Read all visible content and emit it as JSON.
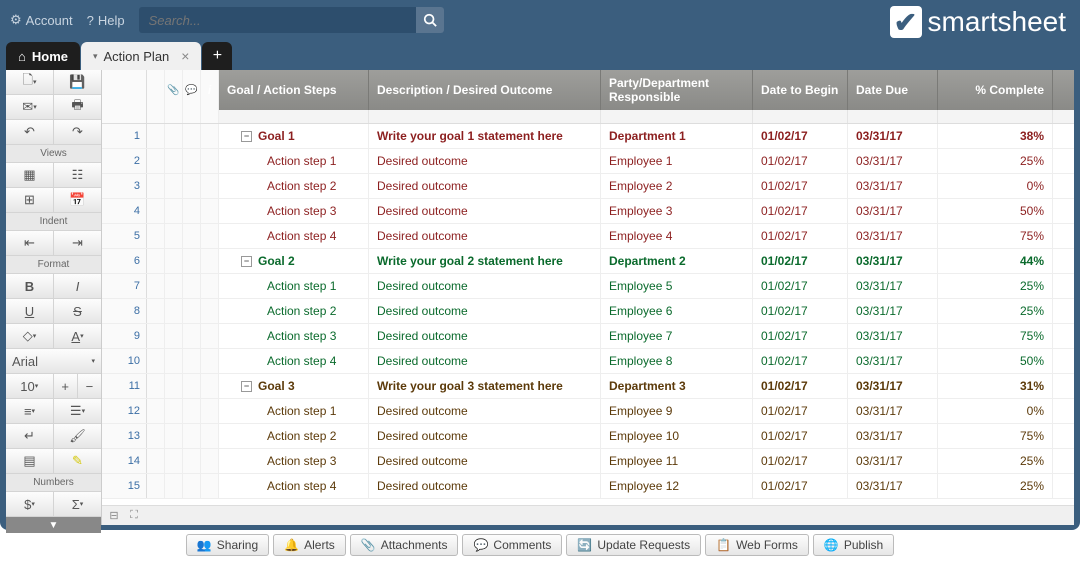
{
  "topbar": {
    "account": "Account",
    "help": "Help",
    "search_placeholder": "Search..."
  },
  "logo": "smartsheet",
  "tabs": {
    "home": "Home",
    "active": "Action Plan"
  },
  "sidebar": {
    "views": "Views",
    "indent": "Indent",
    "format": "Format",
    "font": "Arial",
    "size": "10",
    "numbers": "Numbers"
  },
  "columns": {
    "goal": "Goal / Action Steps",
    "desc": "Description / Desired Outcome",
    "party": "Party/Department Responsible",
    "begin": "Date to Begin",
    "due": "Date Due",
    "pct": "% Complete"
  },
  "rows": [
    {
      "n": 1,
      "type": "goal",
      "color": "red",
      "goal": "Goal 1",
      "desc": "Write your goal 1 statement here",
      "party": "Department 1",
      "begin": "01/02/17",
      "due": "03/31/17",
      "pct": "38%"
    },
    {
      "n": 2,
      "type": "step",
      "color": "red",
      "goal": "Action step 1",
      "desc": "Desired outcome",
      "party": "Employee 1",
      "begin": "01/02/17",
      "due": "03/31/17",
      "pct": "25%"
    },
    {
      "n": 3,
      "type": "step",
      "color": "red",
      "goal": "Action step 2",
      "desc": "Desired outcome",
      "party": "Employee 2",
      "begin": "01/02/17",
      "due": "03/31/17",
      "pct": "0%"
    },
    {
      "n": 4,
      "type": "step",
      "color": "red",
      "goal": "Action step 3",
      "desc": "Desired outcome",
      "party": "Employee 3",
      "begin": "01/02/17",
      "due": "03/31/17",
      "pct": "50%"
    },
    {
      "n": 5,
      "type": "step",
      "color": "red",
      "goal": "Action step 4",
      "desc": "Desired outcome",
      "party": "Employee 4",
      "begin": "01/02/17",
      "due": "03/31/17",
      "pct": "75%"
    },
    {
      "n": 6,
      "type": "goal",
      "color": "green",
      "goal": "Goal 2",
      "desc": "Write your goal 2 statement here",
      "party": "Department 2",
      "begin": "01/02/17",
      "due": "03/31/17",
      "pct": "44%"
    },
    {
      "n": 7,
      "type": "step",
      "color": "green",
      "goal": "Action step 1",
      "desc": "Desired outcome",
      "party": "Employee 5",
      "begin": "01/02/17",
      "due": "03/31/17",
      "pct": "25%"
    },
    {
      "n": 8,
      "type": "step",
      "color": "green",
      "goal": "Action step 2",
      "desc": "Desired outcome",
      "party": "Employee 6",
      "begin": "01/02/17",
      "due": "03/31/17",
      "pct": "25%"
    },
    {
      "n": 9,
      "type": "step",
      "color": "green",
      "goal": "Action step 3",
      "desc": "Desired outcome",
      "party": "Employee 7",
      "begin": "01/02/17",
      "due": "03/31/17",
      "pct": "75%"
    },
    {
      "n": 10,
      "type": "step",
      "color": "green",
      "goal": "Action step 4",
      "desc": "Desired outcome",
      "party": "Employee 8",
      "begin": "01/02/17",
      "due": "03/31/17",
      "pct": "50%"
    },
    {
      "n": 11,
      "type": "goal",
      "color": "brown",
      "goal": "Goal 3",
      "desc": "Write your goal 3 statement here",
      "party": "Department 3",
      "begin": "01/02/17",
      "due": "03/31/17",
      "pct": "31%"
    },
    {
      "n": 12,
      "type": "step",
      "color": "brown",
      "goal": "Action step 1",
      "desc": "Desired outcome",
      "party": "Employee 9",
      "begin": "01/02/17",
      "due": "03/31/17",
      "pct": "0%"
    },
    {
      "n": 13,
      "type": "step",
      "color": "brown",
      "goal": "Action step 2",
      "desc": "Desired outcome",
      "party": "Employee 10",
      "begin": "01/02/17",
      "due": "03/31/17",
      "pct": "75%"
    },
    {
      "n": 14,
      "type": "step",
      "color": "brown",
      "goal": "Action step 3",
      "desc": "Desired outcome",
      "party": "Employee 11",
      "begin": "01/02/17",
      "due": "03/31/17",
      "pct": "25%"
    },
    {
      "n": 15,
      "type": "step",
      "color": "brown",
      "goal": "Action step 4",
      "desc": "Desired outcome",
      "party": "Employee 12",
      "begin": "01/02/17",
      "due": "03/31/17",
      "pct": "25%"
    }
  ],
  "bottom": {
    "sharing": "Sharing",
    "alerts": "Alerts",
    "attachments": "Attachments",
    "comments": "Comments",
    "updates": "Update Requests",
    "forms": "Web Forms",
    "publish": "Publish"
  }
}
